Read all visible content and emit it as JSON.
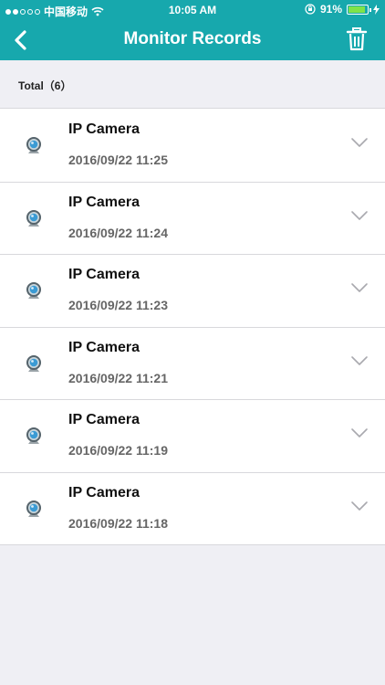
{
  "status": {
    "carrier": "中国移动",
    "time": "10:05 AM",
    "battery": "91%",
    "battery_level": 0.91
  },
  "header": {
    "title": "Monitor Records",
    "back_icon": "back-chevron-icon",
    "trash_icon": "trash-icon"
  },
  "summary": {
    "total_label": "Total（6）"
  },
  "records": [
    {
      "name": "IP Camera",
      "date": "2016/09/22  11:25"
    },
    {
      "name": "IP Camera",
      "date": "2016/09/22  11:24"
    },
    {
      "name": "IP Camera",
      "date": "2016/09/22  11:23"
    },
    {
      "name": "IP Camera",
      "date": "2016/09/22  11:21"
    },
    {
      "name": "IP Camera",
      "date": "2016/09/22  11:19"
    },
    {
      "name": "IP Camera",
      "date": "2016/09/22  11:18"
    }
  ],
  "colors": {
    "accent": "#17a8ad",
    "background": "#efeff4",
    "battery": "#7fe34a"
  }
}
